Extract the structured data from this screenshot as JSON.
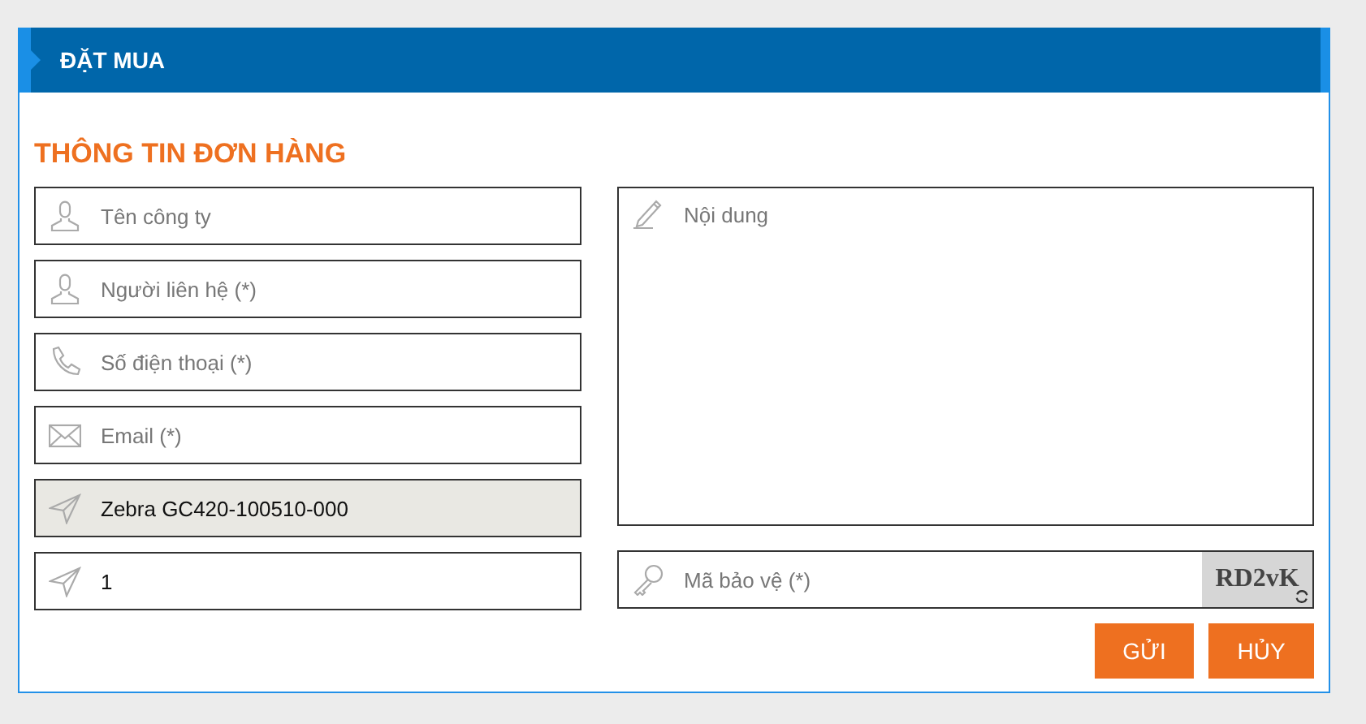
{
  "panel": {
    "title": "ĐẶT MUA"
  },
  "section_title": "THÔNG TIN ĐƠN HÀNG",
  "fields": [
    {
      "kind": "person",
      "placeholder": "Tên công ty",
      "disabled": false
    },
    {
      "kind": "person",
      "placeholder": "Người liên hệ (*)",
      "disabled": false
    },
    {
      "kind": "phone",
      "placeholder": "Số điện thoại (*)",
      "disabled": false
    },
    {
      "kind": "mail",
      "placeholder": "Email (*)",
      "disabled": false
    },
    {
      "kind": "send",
      "value": "Zebra GC420-100510-000",
      "disabled": true
    },
    {
      "kind": "send",
      "value": "1",
      "disabled": false
    }
  ],
  "message": {
    "placeholder": "Nội dung"
  },
  "captcha": {
    "placeholder": "Mã bảo vệ (*)",
    "code": "RD2vK"
  },
  "buttons": [
    "GỬI",
    "HỦY"
  ]
}
